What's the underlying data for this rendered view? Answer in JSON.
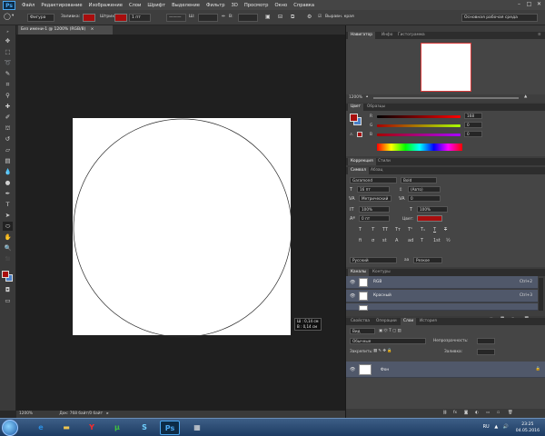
{
  "app": {
    "logo": "Ps",
    "menu": [
      "Файл",
      "Редактирование",
      "Изображение",
      "Слои",
      "Шрифт",
      "Выделение",
      "Фильтр",
      "3D",
      "Просмотр",
      "Окно",
      "Справка"
    ],
    "window_controls": [
      "–",
      "□",
      "✕"
    ]
  },
  "options_bar": {
    "shape_mode": "Фигура",
    "fill_label": "Заливка:",
    "stroke_label": "Штрих:",
    "stroke_width": "1 пт",
    "w_label": "Ш:",
    "h_label": "В:",
    "align_edges_label": "Выравн. края",
    "workspace": "Основная рабочая среда",
    "fill_color": "#a80d0d"
  },
  "document": {
    "tab_title": "Без имени-1 @ 1200% (RGB/8)",
    "close_glyph": "×",
    "zoom": "1200%",
    "doc_info": "Док: 768 байт/0 байт",
    "measure_w": "Ш : 0,14 см",
    "measure_h": "В : 0,14 см"
  },
  "navigator": {
    "tabs": [
      "Навигатор",
      "Инфо",
      "Гистограмма"
    ],
    "zoom": "1200%"
  },
  "color_panel": {
    "tabs": [
      "Цвет",
      "Образцы"
    ],
    "r_label": "R",
    "g_label": "G",
    "b_label": "B",
    "r_value": "168",
    "g_value": "0",
    "b_value": "0",
    "fg_color": "#a80d0d",
    "bg_color": "#4a80c8"
  },
  "adjust_tabs": [
    "Коррекция",
    "Стили"
  ],
  "character_panel": {
    "tabs": [
      "Символ",
      "Абзац"
    ],
    "font_family": "Garamond",
    "font_style": "Bold",
    "font_size": "16 пт",
    "leading": "(Авто)",
    "kerning": "Метрический",
    "tracking": "0",
    "vscale": "100%",
    "hscale": "100%",
    "baseline": "0 пт",
    "color_label": "Цвет:",
    "text_color": "#a80d0d",
    "style_buttons": [
      "T",
      "T",
      "TT",
      "Tт",
      "T¹",
      "T₁",
      "T",
      "T"
    ],
    "opentype_buttons": [
      "fi",
      "σ",
      "st",
      "A",
      "ad",
      "T",
      "1st",
      "½"
    ],
    "language": "Русский",
    "antialias_icon": "aa",
    "antialias": "Резкое"
  },
  "channels_panel": {
    "tabs": [
      "Каналы",
      "Контуры"
    ],
    "rows": [
      {
        "name": "RGB",
        "shortcut": "Ctrl+2"
      },
      {
        "name": "Красный",
        "shortcut": "Ctrl+3"
      },
      {
        "name": "",
        "shortcut": ""
      }
    ]
  },
  "layers_panel": {
    "tabs": [
      "Свойства",
      "Операции",
      "Слои",
      "История"
    ],
    "kind_filter": "Вид",
    "blend_mode": "Обычные",
    "opacity_label": "Непрозрачность:",
    "lock_label": "Закрепить:",
    "fill_label": "Заливка:",
    "layers": [
      {
        "name": "Фон",
        "locked": true
      }
    ]
  },
  "taskbar": {
    "ps_label": "Ps",
    "lang": "RU",
    "time": "23:25",
    "date": "04.05.2016"
  }
}
